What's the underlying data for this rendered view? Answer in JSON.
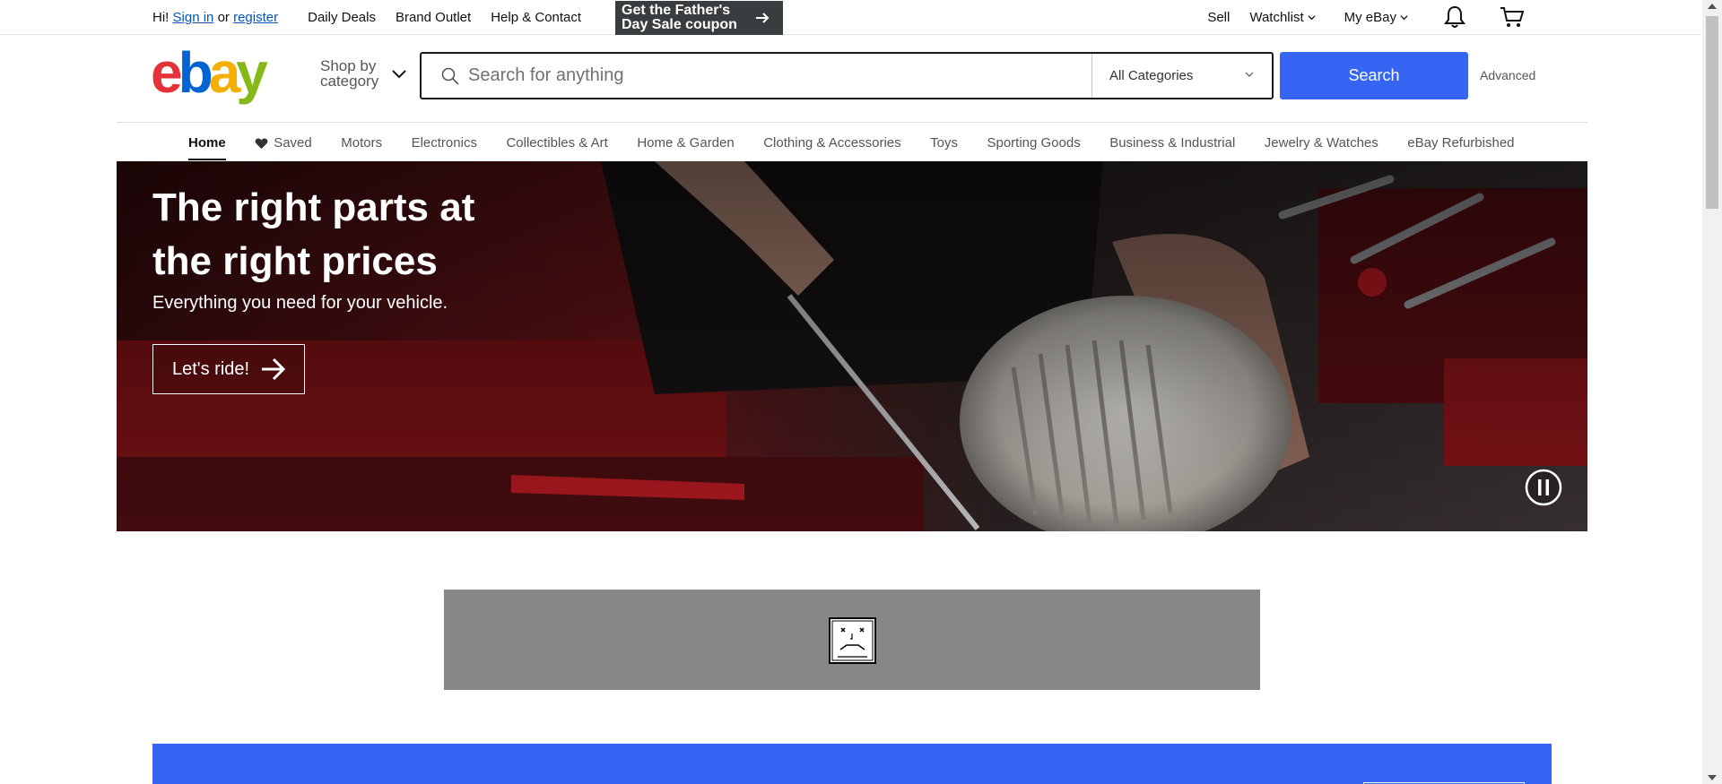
{
  "topbar": {
    "greeting": "Hi!",
    "sign_in": "Sign in",
    "or": "or",
    "register": "register",
    "links": [
      "Daily Deals",
      "Brand Outlet",
      "Help & Contact"
    ],
    "promo_line1": "Get the Father's",
    "promo_line2": "Day Sale coupon",
    "sell": "Sell",
    "watchlist": "Watchlist",
    "my_ebay": "My eBay"
  },
  "header": {
    "logo_letters": [
      "e",
      "b",
      "a",
      "y"
    ],
    "logo_colors": [
      "#e53238",
      "#0064d2",
      "#f5af02",
      "#86b817"
    ],
    "shop_by_line1": "Shop by",
    "shop_by_line2": "category",
    "search_placeholder": "Search for anything",
    "category_selected": "All Categories",
    "search_button": "Search",
    "advanced": "Advanced"
  },
  "catnav": {
    "items": [
      "Home",
      "Saved",
      "Motors",
      "Electronics",
      "Collectibles & Art",
      "Home & Garden",
      "Clothing & Accessories",
      "Toys",
      "Sporting Goods",
      "Business & Industrial",
      "Jewelry & Watches",
      "eBay Refurbished"
    ],
    "active": "Home"
  },
  "hero": {
    "title": "The right parts at the right prices",
    "subtitle": "Everything you need for your vehicle.",
    "cta": "Let's ride!"
  },
  "colors": {
    "accent_blue": "#3665f3",
    "link_blue": "#0654ba",
    "ad_gray": "#878787"
  }
}
